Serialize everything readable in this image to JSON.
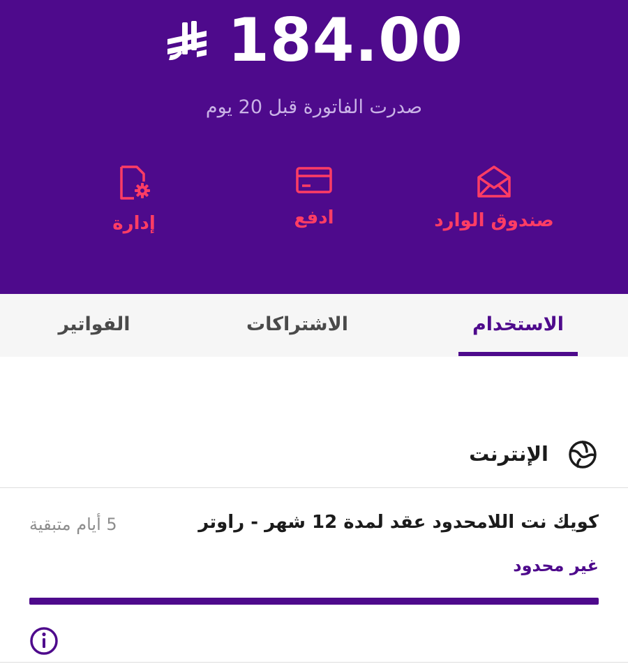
{
  "balance": {
    "amount": "184.00",
    "currency_icon": "saudi-riyal-symbol",
    "issued_text": "صدرت الفاتورة قبل 20 يوم"
  },
  "actions": [
    {
      "label": "صندوق الوارد",
      "icon": "envelope-icon"
    },
    {
      "label": "ادفع",
      "icon": "credit-card-icon"
    },
    {
      "label": "إدارة",
      "icon": "document-gear-icon"
    }
  ],
  "tabs": {
    "usage": "الاستخدام",
    "subscriptions": "الاشتراكات",
    "bills": "الفواتير",
    "active": "usage"
  },
  "internet": {
    "section_title": "الإنترنت",
    "plan_name": "كويك نت اللامحدود عقد لمدة 12 شهر - راوتر",
    "days_left": "5 أيام متبقية",
    "allowance": "غير محدود",
    "usage_fraction": 1.0
  },
  "colors": {
    "brand_purple": "#4e0a8c",
    "accent_red": "#ff3d64",
    "muted_lilac": "#c9b2e6"
  }
}
